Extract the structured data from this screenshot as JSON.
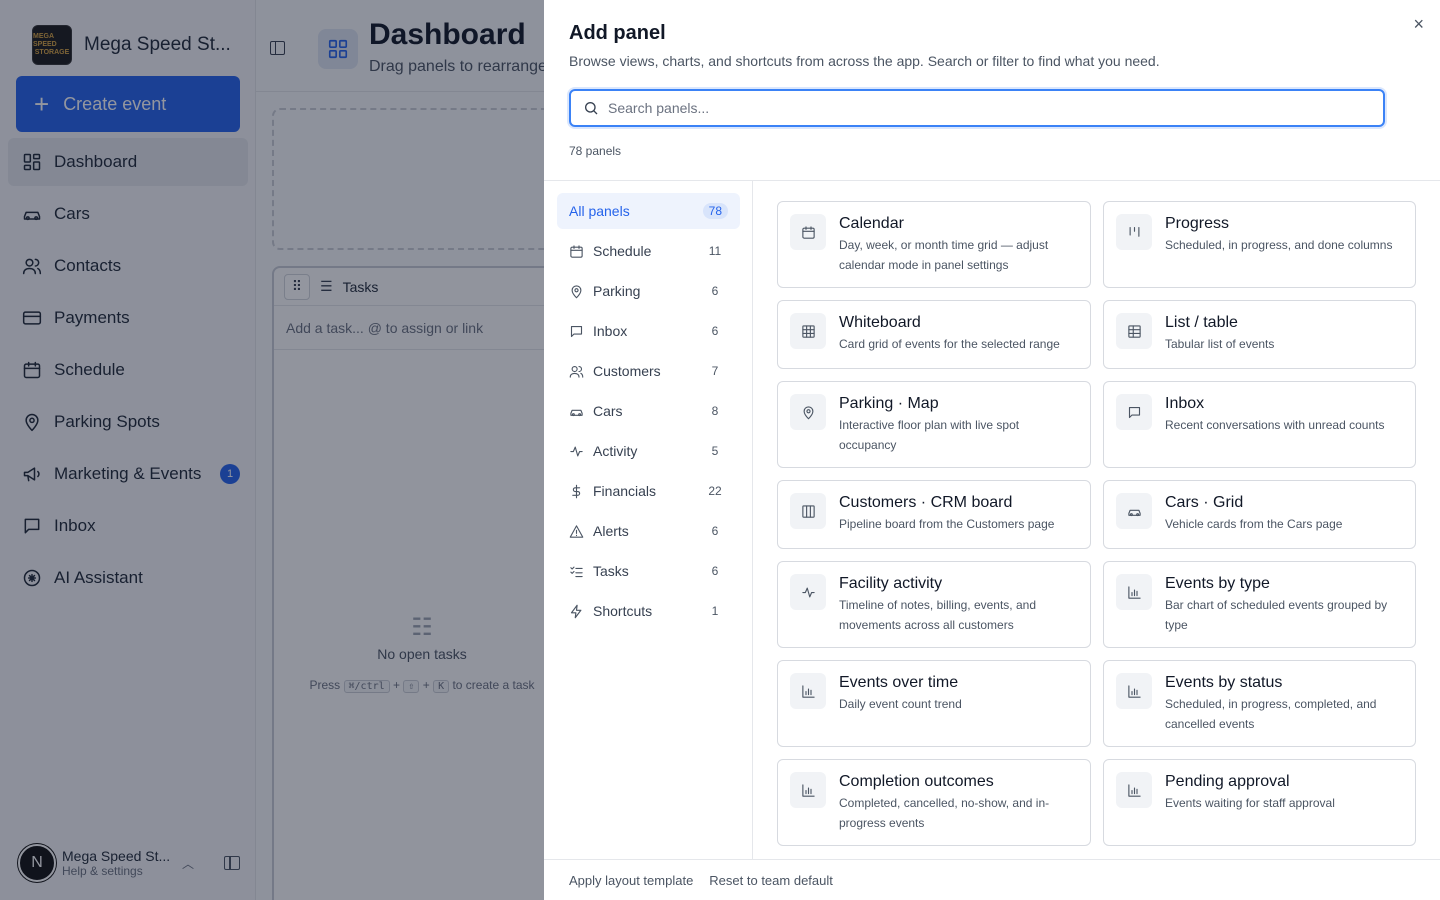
{
  "app": {
    "brand_name": "Mega Speed St...",
    "logo_text": [
      "MEGA SPEED",
      "STORAGE"
    ],
    "create_label": "Create event",
    "nav": [
      {
        "label": "Dashboard",
        "icon": "dashboard-icon"
      },
      {
        "label": "Cars",
        "icon": "car-icon"
      },
      {
        "label": "Contacts",
        "icon": "contacts-icon"
      },
      {
        "label": "Payments",
        "icon": "credit-card-icon"
      },
      {
        "label": "Schedule",
        "icon": "calendar-icon"
      },
      {
        "label": "Parking Spots",
        "icon": "map-pin-icon"
      },
      {
        "label": "Marketing & Events",
        "icon": "megaphone-icon",
        "badge": "1"
      },
      {
        "label": "Inbox",
        "icon": "message-icon"
      },
      {
        "label": "AI Assistant",
        "icon": "ai-icon"
      }
    ],
    "user": {
      "initial": "N",
      "name": "Mega Speed St...",
      "sub": "Help & settings"
    },
    "page_title": "Dashboard",
    "page_subtitle": "Drag panels to rearrange",
    "tasks": {
      "title": "Tasks",
      "add_placeholder": "Add a task... @ to assign or link",
      "empty_title": "No open tasks",
      "press": "Press",
      "key_cmd": "⌘/ctrl",
      "key_shift": "⇧",
      "key_k": "K",
      "to_create": "to create a task",
      "plus": "+"
    }
  },
  "drawer": {
    "title": "Add panel",
    "subtitle": "Browse views, charts, and shortcuts from across the app. Search or filter to find what you need.",
    "search_placeholder": "Search panels...",
    "count_label": "78 panels",
    "close_label": "×",
    "categories": [
      {
        "label": "All panels",
        "count": "78",
        "icon": "none"
      },
      {
        "label": "Schedule",
        "count": "11",
        "icon": "calendar-icon"
      },
      {
        "label": "Parking",
        "count": "6",
        "icon": "map-pin-icon"
      },
      {
        "label": "Inbox",
        "count": "6",
        "icon": "message-icon"
      },
      {
        "label": "Customers",
        "count": "7",
        "icon": "contacts-icon"
      },
      {
        "label": "Cars",
        "count": "8",
        "icon": "car-icon"
      },
      {
        "label": "Activity",
        "count": "5",
        "icon": "activity-icon"
      },
      {
        "label": "Financials",
        "count": "22",
        "icon": "dollar-icon"
      },
      {
        "label": "Alerts",
        "count": "6",
        "icon": "alert-icon"
      },
      {
        "label": "Tasks",
        "count": "6",
        "icon": "checklist-icon"
      },
      {
        "label": "Shortcuts",
        "count": "1",
        "icon": "bolt-icon"
      }
    ],
    "panels": [
      {
        "title": "Calendar",
        "desc": "Day, week, or month time grid — adjust calendar mode in panel settings",
        "icon": "calendar-icon"
      },
      {
        "title": "Progress",
        "desc": "Scheduled, in progress, and done columns",
        "icon": "columns-icon"
      },
      {
        "title": "Whiteboard",
        "desc": "Card grid of events for the selected range",
        "icon": "grid-icon"
      },
      {
        "title": "List / table",
        "desc": "Tabular list of events",
        "icon": "table-icon"
      },
      {
        "title": "Parking · Map",
        "desc": "Interactive floor plan with live spot occupancy",
        "icon": "map-pin-icon"
      },
      {
        "title": "Inbox",
        "desc": "Recent conversations with unread counts",
        "icon": "message-icon"
      },
      {
        "title": "Customers · CRM board",
        "desc": "Pipeline board from the Customers page",
        "icon": "board-icon"
      },
      {
        "title": "Cars · Grid",
        "desc": "Vehicle cards from the Cars page",
        "icon": "car-icon"
      },
      {
        "title": "Facility activity",
        "desc": "Timeline of notes, billing, events, and movements across all customers",
        "icon": "activity-icon"
      },
      {
        "title": "Events by type",
        "desc": "Bar chart of scheduled events grouped by type",
        "icon": "bar-chart-icon"
      },
      {
        "title": "Events over time",
        "desc": "Daily event count trend",
        "icon": "bar-chart-icon"
      },
      {
        "title": "Events by status",
        "desc": "Scheduled, in progress, completed, and cancelled events",
        "icon": "bar-chart-icon"
      },
      {
        "title": "Completion outcomes",
        "desc": "Completed, cancelled, no-show, and in-progress events",
        "icon": "bar-chart-icon"
      },
      {
        "title": "Pending approval",
        "desc": "Events waiting for staff approval",
        "icon": "bar-chart-icon"
      }
    ],
    "footer": {
      "apply": "Apply layout template",
      "reset": "Reset to team default"
    }
  },
  "colors": {
    "accent": "#2563eb",
    "overlay": "rgba(15,23,42,0.45)"
  }
}
